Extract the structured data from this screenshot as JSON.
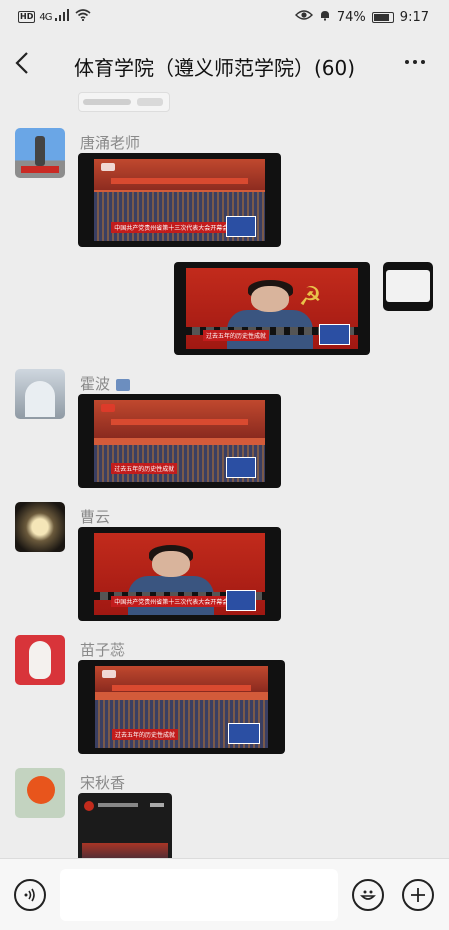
{
  "status_bar": {
    "hd": "HD",
    "network": "4G",
    "battery": "74%",
    "time": "9:17",
    "icons": [
      "hd-icon",
      "signal-icon",
      "wifi-icon",
      "eye-icon",
      "alarm-icon",
      "battery-icon"
    ]
  },
  "header": {
    "back_icon": "chevron-left-icon",
    "title": "体育学院（遵义师范学院）(60)",
    "more_icon": "more-icon"
  },
  "messages": [
    {
      "type": "video",
      "from": "",
      "outgoing": false,
      "partial": true
    },
    {
      "type": "video",
      "from": "唐涌老师",
      "caption": "中国共产党贵州省第十三次代表大会开幕会",
      "scene": "hall"
    },
    {
      "type": "video",
      "from": "self",
      "outgoing": true,
      "caption": "过去五年的历史性成就",
      "scene": "portrait"
    },
    {
      "type": "video",
      "from": "霍波",
      "caption": "过去五年的历史性成就",
      "scene": "hall",
      "badge": true
    },
    {
      "type": "video",
      "from": "曹云",
      "caption": "中国共产党贵州省第十三次代表大会开幕会",
      "scene": "portrait"
    },
    {
      "type": "video",
      "from": "苗子蕊",
      "caption": "过去五年的历史性成就",
      "scene": "hall"
    },
    {
      "type": "video",
      "from": "宋秋香",
      "caption": "",
      "scene": "phone",
      "partial": true
    }
  ],
  "senders": {
    "tang": "唐涌老师",
    "huo": "霍波",
    "cao": "曹云",
    "miao": "苗子蕊",
    "song": "宋秋香"
  },
  "captions": {
    "opening": "中国共产党贵州省第十三次代表大会开幕会",
    "achievements": "过去五年的历史性成就"
  },
  "input_bar": {
    "voice_icon": "voice-icon",
    "emoji_icon": "emoji-icon",
    "plus_icon": "plus-icon"
  },
  "colors": {
    "background": "#ededed",
    "input_bar": "#f7f7f7",
    "caption_red": "#c21c1c"
  }
}
